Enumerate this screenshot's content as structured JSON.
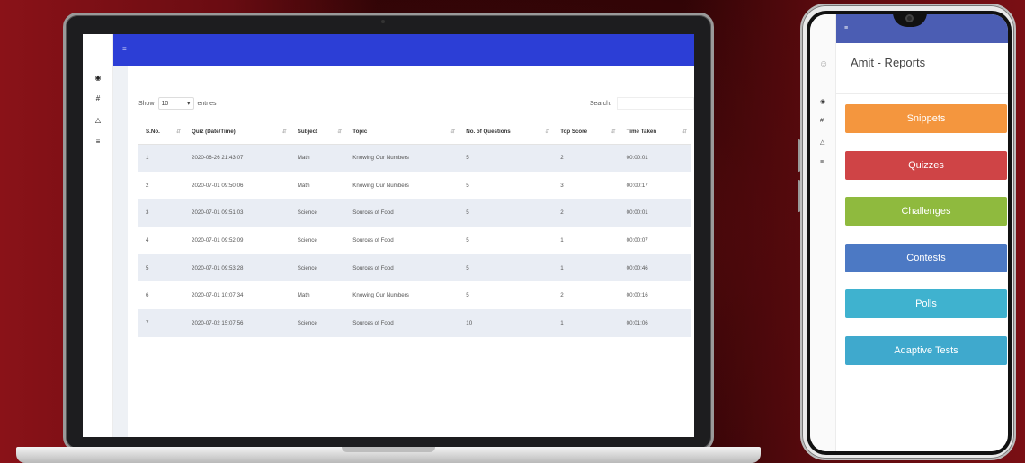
{
  "laptop": {
    "table_controls": {
      "show_label": "Show",
      "entries_value": "10",
      "entries_label": "entries",
      "search_label": "Search:"
    },
    "table": {
      "columns": [
        "S.No.",
        "Quiz (Date/Time)",
        "Subject",
        "Topic",
        "No. of Questions",
        "Top Score",
        "Time Taken"
      ],
      "rows": [
        [
          "1",
          "2020-06-26 21:43:07",
          "Math",
          "Knowing Our Numbers",
          "5",
          "2",
          "00:00:01"
        ],
        [
          "2",
          "2020-07-01 09:50:06",
          "Math",
          "Knowing Our Numbers",
          "5",
          "3",
          "00:00:17"
        ],
        [
          "3",
          "2020-07-01 09:51:03",
          "Science",
          "Sources of Food",
          "5",
          "2",
          "00:00:01"
        ],
        [
          "4",
          "2020-07-01 09:52:09",
          "Science",
          "Sources of Food",
          "5",
          "1",
          "00:00:07"
        ],
        [
          "5",
          "2020-07-01 09:53:28",
          "Science",
          "Sources of Food",
          "5",
          "1",
          "00:00:46"
        ],
        [
          "6",
          "2020-07-01 10:07:34",
          "Math",
          "Knowing Our Numbers",
          "5",
          "2",
          "00:00:16"
        ],
        [
          "7",
          "2020-07-02 15:07:56",
          "Science",
          "Sources of Food",
          "10",
          "1",
          "00:01:06"
        ]
      ]
    },
    "icons": {
      "menu": "hamburger-icon",
      "sidebar": [
        "home-icon",
        "hash-icon",
        "trophy-icon",
        "list-icon"
      ]
    },
    "colors": {
      "topbar": "#2c3ed6",
      "row_stripe": "#e9edf4"
    }
  },
  "phone": {
    "title": "Amit - Reports",
    "buttons": [
      {
        "label": "Snippets",
        "color": "#f4963e"
      },
      {
        "label": "Quizzes",
        "color": "#cf4446"
      },
      {
        "label": "Challenges",
        "color": "#8fba3e"
      },
      {
        "label": "Contests",
        "color": "#4c79c4"
      },
      {
        "label": "Polls",
        "color": "#3fb2cf"
      },
      {
        "label": "Adaptive Tests",
        "color": "#3fa9cd"
      }
    ],
    "colors": {
      "topbar": "#4b5db3"
    }
  }
}
